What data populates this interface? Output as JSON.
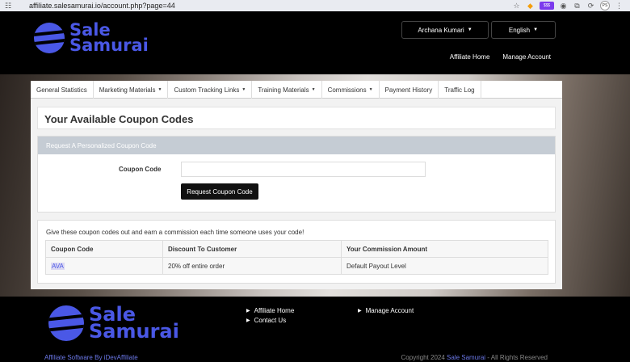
{
  "browser": {
    "url": "affiliate.salesamurai.io/account.php?page=44",
    "badge": "$$$",
    "avatar": "PS"
  },
  "header": {
    "logo_line1": "Sale",
    "logo_line2": "Samurai",
    "user_menu": "Archana Kumari",
    "language": "English",
    "links": [
      "Affiliate Home",
      "Manage Account"
    ]
  },
  "nav": [
    {
      "label": "General Statistics",
      "has_dropdown": false
    },
    {
      "label": "Marketing Materials",
      "has_dropdown": true
    },
    {
      "label": "Custom Tracking Links",
      "has_dropdown": true
    },
    {
      "label": "Training Materials",
      "has_dropdown": true
    },
    {
      "label": "Commissions",
      "has_dropdown": true
    },
    {
      "label": "Payment History",
      "has_dropdown": false
    },
    {
      "label": "Traffic Log",
      "has_dropdown": false
    }
  ],
  "page_title": "Your Available Coupon Codes",
  "request": {
    "heading": "Request A Personalized Coupon Code",
    "label": "Coupon Code",
    "input_value": "",
    "button": "Request Coupon Code"
  },
  "coupons": {
    "intro": "Give these coupon codes out and earn a commission each time someone uses your code!",
    "columns": [
      "Coupon Code",
      "Discount To Customer",
      "Your Commission Amount"
    ],
    "rows": [
      {
        "code": "AVA",
        "discount": "20% off entire order",
        "commission": "Default Payout Level"
      }
    ]
  },
  "footer": {
    "links_col1": [
      "Affiliate Home",
      "Contact Us"
    ],
    "links_col2": [
      "Manage Account"
    ],
    "powered_by": "Affiliate Software By iDevAffiliate",
    "copyright_prefix": "Copyright 2024",
    "copyright_brand": "Sale Samurai",
    "copyright_suffix": "- All Rights Reserved"
  },
  "colors": {
    "brand": "#4a58e6",
    "header_bg": "#000000",
    "request_header": "#c5ccd4"
  },
  "icons": [
    "tune-icon",
    "star-icon",
    "brave-icon",
    "extension-icon",
    "puzzle-icon",
    "sync-icon",
    "menu-icon"
  ]
}
